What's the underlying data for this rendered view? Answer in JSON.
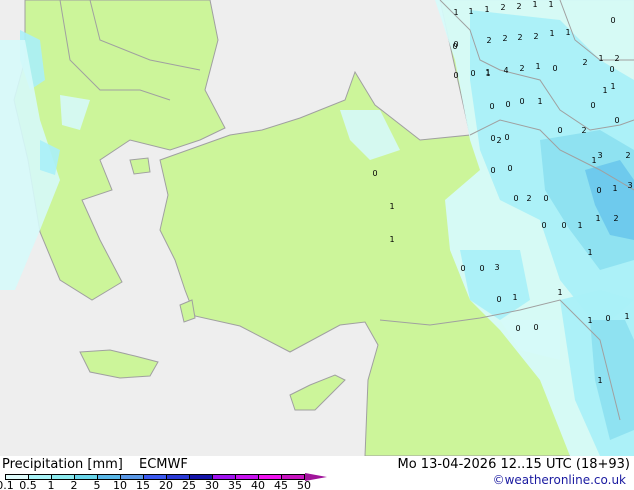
{
  "title": "Precipitation [mm]",
  "model": "ECMWF",
  "datetime": "Mo 13-04-2026 12..15 UTC (18+93)",
  "credit": "©weatheronline.co.uk",
  "legend": {
    "ticks": [
      "0.1",
      "0.5",
      "1",
      "2",
      "5",
      "10",
      "15",
      "20",
      "25",
      "30",
      "35",
      "40",
      "45",
      "50"
    ],
    "colors": [
      "#e0fcfc",
      "#aaf4f8",
      "#8ceaee",
      "#6ad6ea",
      "#5ab8e8",
      "#5a98e6",
      "#3c5af0",
      "#2a3ad6",
      "#1414aa",
      "#a014f0",
      "#c814f0",
      "#f014f0",
      "#c814c0"
    ],
    "arrow_color": "#a0149a"
  },
  "colors": {
    "sea": "#eeeeee",
    "land": "#ccf59a",
    "border": "#a0a0a0"
  },
  "map_labels": [
    "1",
    "1",
    "1",
    "2",
    "2",
    "1",
    "1",
    "0",
    "0",
    "0",
    "1",
    "2",
    "2",
    "2",
    "2",
    "1",
    "1",
    "0",
    "1",
    "4",
    "2",
    "1",
    "0",
    "0",
    "2",
    "1",
    "2",
    "0",
    "1",
    "0",
    "0",
    "0",
    "0",
    "0",
    "0",
    "1",
    "2",
    "1",
    "2",
    "0",
    "0",
    "2",
    "3",
    "1",
    "3",
    "0",
    "0",
    "0",
    "0",
    "0",
    "1",
    "1",
    "0",
    "0",
    "1",
    "2",
    "2",
    "0",
    "0",
    "3",
    "1",
    "0",
    "1",
    "1",
    "0",
    "1",
    "0",
    "0",
    "1",
    "1",
    "0",
    "1",
    "1"
  ]
}
